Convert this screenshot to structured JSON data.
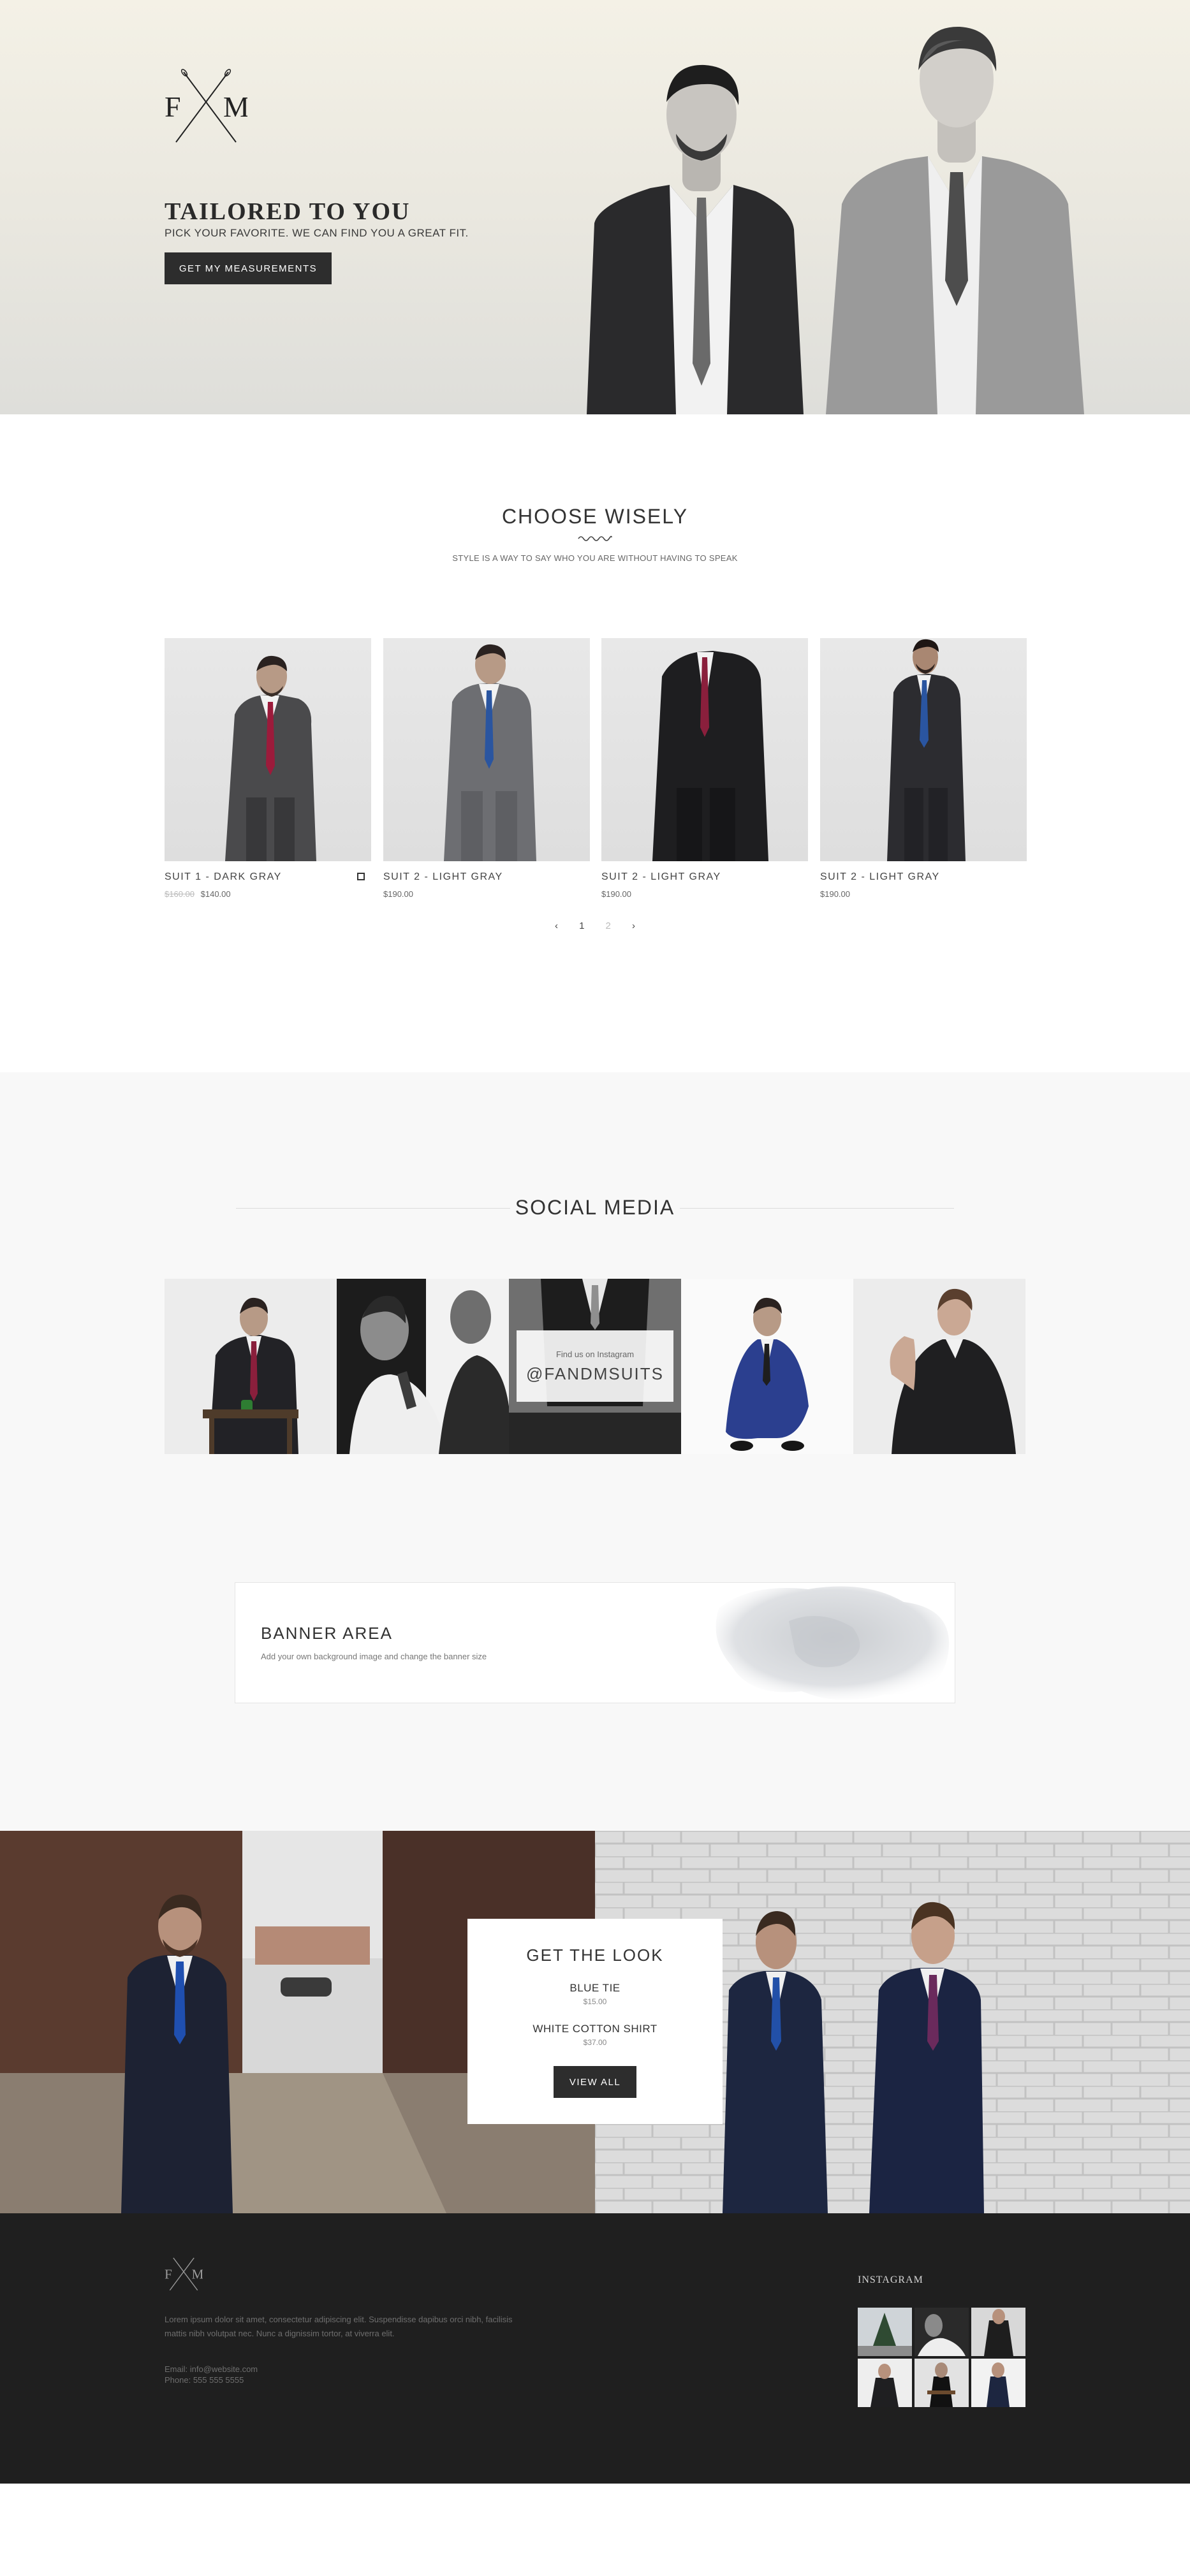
{
  "hero": {
    "logo_letters": "F M",
    "title": "TAILORED TO YOU",
    "subtitle": "PICK YOUR FAVORITE. WE CAN FIND YOU A GREAT FIT.",
    "button_label": "GET MY MEASUREMENTS"
  },
  "collection": {
    "title": "CHOOSE WISELY",
    "subtitle": "STYLE IS A WAY TO SAY WHO YOU ARE WITHOUT HAVING TO SPEAK",
    "products": [
      {
        "name": "SUIT 1 - DARK GRAY",
        "old_price": "$160.00",
        "price": "$140.00",
        "tie": "#9c1b3b",
        "suit": "#4a4a4c"
      },
      {
        "name": "SUIT 2 - LIGHT GRAY",
        "old_price": "",
        "price": "$190.00",
        "tie": "#2a55a0",
        "suit": "#6d6e72"
      },
      {
        "name": "SUIT 2 - LIGHT GRAY",
        "old_price": "",
        "price": "$190.00",
        "tie": "#8a1f3c",
        "suit": "#1e1e20"
      },
      {
        "name": "SUIT 2 - LIGHT GRAY",
        "old_price": "",
        "price": "$190.00",
        "tie": "#2a55a0",
        "suit": "#2c2c30"
      }
    ],
    "pager": {
      "prev": "‹",
      "current": "1",
      "next_page": "2",
      "next": "›"
    }
  },
  "social": {
    "title": "SOCIAL MEDIA",
    "overlay_small": "Find us on Instagram",
    "overlay_handle": "@FANDMSUITS"
  },
  "banner": {
    "title": "BANNER AREA",
    "subtitle": "Add your own background image and change the banner size"
  },
  "look": {
    "title": "GET THE LOOK",
    "items": [
      {
        "name": "BLUE TIE",
        "price": "$15.00"
      },
      {
        "name": "WHITE COTTON SHIRT",
        "price": "$37.00"
      }
    ],
    "button_label": "VIEW ALL"
  },
  "footer": {
    "logo_letters": "F M",
    "text": "Lorem ipsum dolor sit amet, consectetur adipiscing elit. Suspendisse dapibus orci nibh, facilisis mattis nibh volutpat nec. Nunc a dignissim tortor, at viverra elit.",
    "email": "Email: info@website.com",
    "phone": "Phone: 555 555 5555",
    "instagram_title": "INSTAGRAM"
  },
  "colors": {
    "dark": "#2d2d2d",
    "footer_bg": "#1f1f1f",
    "section_gray": "#f8f8f8"
  }
}
